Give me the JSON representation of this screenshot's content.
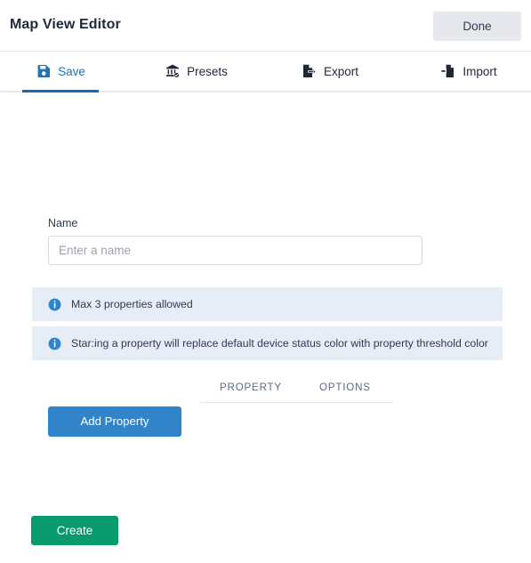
{
  "header": {
    "title": "Map View Editor",
    "done_label": "Done"
  },
  "tabs": [
    {
      "id": "save",
      "label": "Save",
      "icon": "floppy-disk-icon",
      "active": true
    },
    {
      "id": "presets",
      "label": "Presets",
      "icon": "bank-check-icon",
      "active": false
    },
    {
      "id": "export",
      "label": "Export",
      "icon": "document-export-icon",
      "active": false
    },
    {
      "id": "import",
      "label": "Import",
      "icon": "document-import-icon",
      "active": false
    }
  ],
  "form": {
    "name_label": "Name",
    "name_value": "",
    "name_placeholder": "Enter a name"
  },
  "alerts": [
    {
      "id": "max-properties",
      "icon": "info-icon",
      "text": "Max 3 properties allowed"
    },
    {
      "id": "star-property",
      "icon": "info-icon",
      "text": "Star:ing a property will replace default device status color with property threshold color"
    }
  ],
  "subtabs": [
    {
      "id": "property",
      "label": "PROPERTY"
    },
    {
      "id": "options",
      "label": "OPTIONS"
    }
  ],
  "actions": {
    "add_property_label": "Add Property",
    "create_label": "Create"
  },
  "colors": {
    "accent_blue": "#3184ca",
    "tab_active_blue": "#2272b4",
    "create_green": "#089a6d",
    "alert_background": "#e6edf7",
    "done_background": "#e6e8ed"
  }
}
